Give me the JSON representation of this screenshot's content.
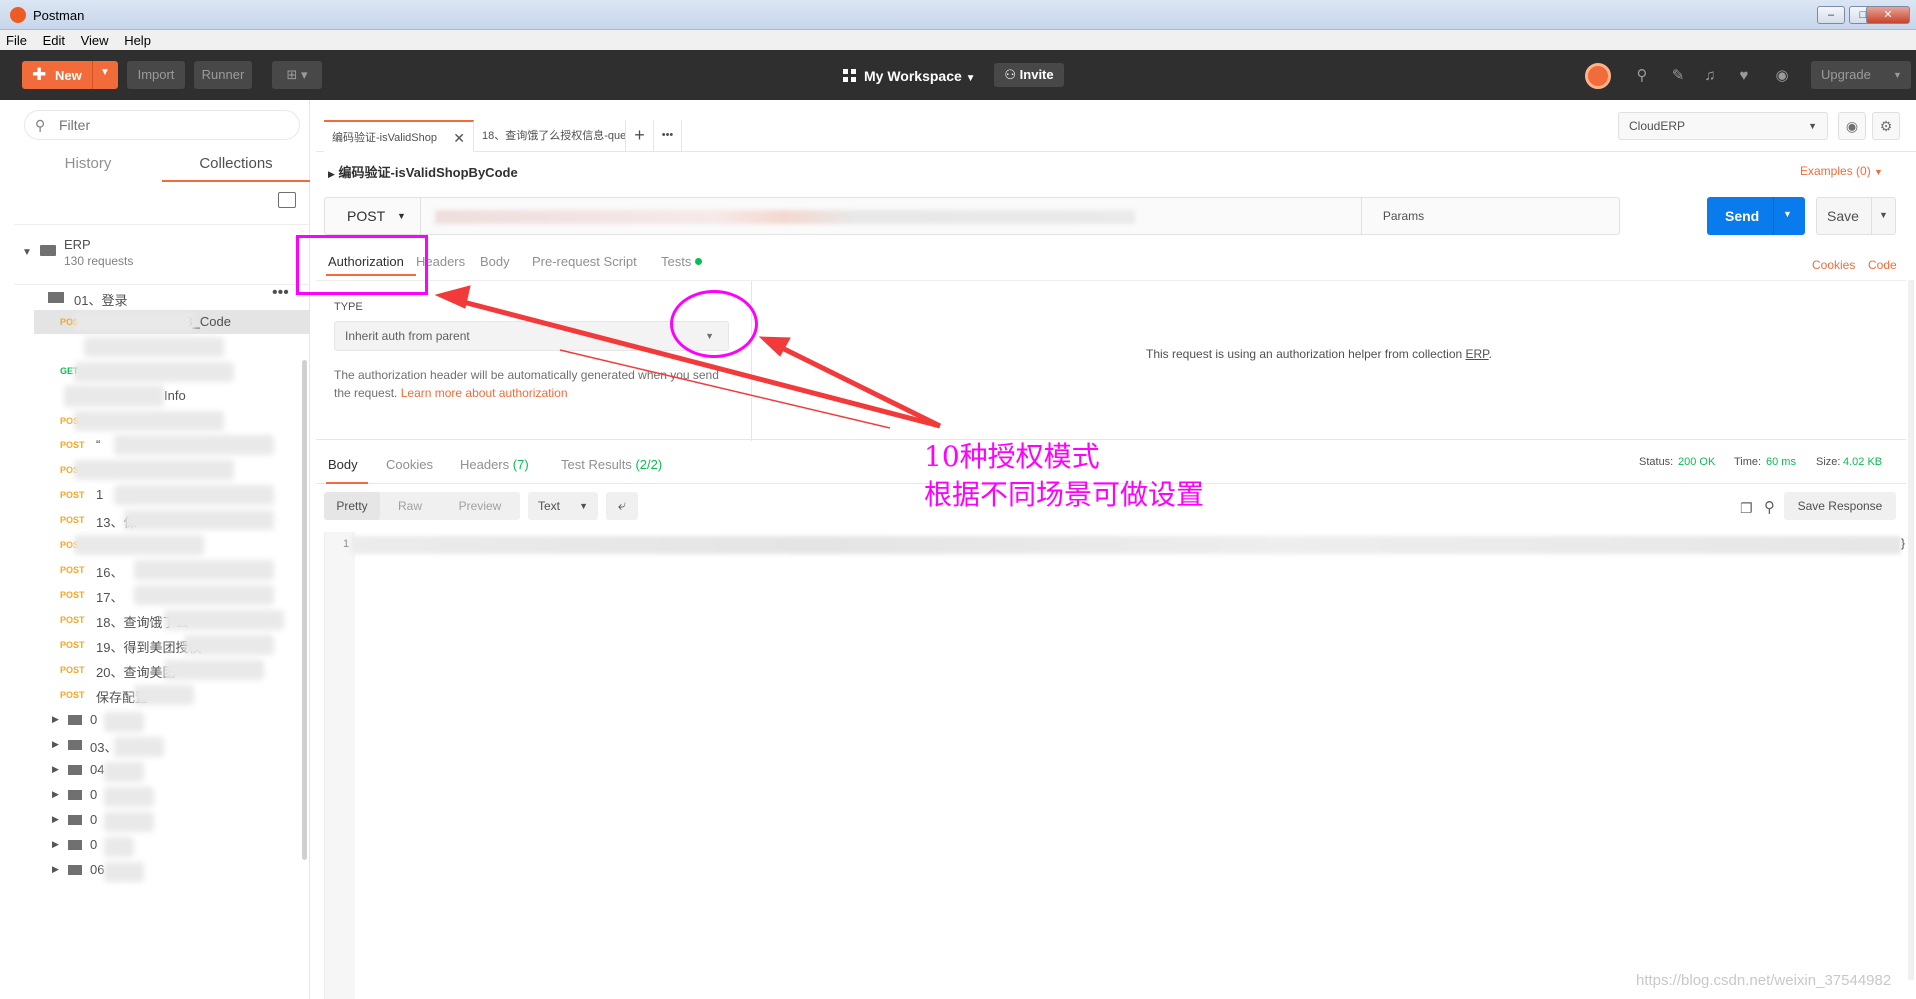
{
  "window": {
    "title": "Postman",
    "minimize": "–",
    "maximize": "□",
    "close": "✕"
  },
  "menu": [
    "File",
    "Edit",
    "View",
    "Help"
  ],
  "header": {
    "new_label": "New",
    "import_label": "Import",
    "runner_label": "Runner",
    "workspace_label": "My Workspace",
    "invite_label": "Invite",
    "upgrade_label": "Upgrade"
  },
  "sidebar": {
    "filter_placeholder": "Filter",
    "tabs": {
      "history": "History",
      "collections": "Collections"
    },
    "collection": {
      "name": "ERP",
      "count": "130 requests"
    },
    "open_folder": "01、登录",
    "requests": [
      {
        "method": "POST",
        "text": "B_Code"
      },
      {
        "method": "",
        "text": ""
      },
      {
        "method": "GET",
        "text": "-"
      },
      {
        "method": "",
        "text": "Info"
      },
      {
        "method": "POST",
        "text": ""
      },
      {
        "method": "POST",
        "text": "“"
      },
      {
        "method": "POST",
        "text": ""
      },
      {
        "method": "POST",
        "text": "1"
      },
      {
        "method": "POST",
        "text": "13、保"
      },
      {
        "method": "POST",
        "text": ""
      },
      {
        "method": "POST",
        "text": "16、"
      },
      {
        "method": "POST",
        "text": "17、"
      },
      {
        "method": "POST",
        "text": "18、查询饿了么"
      },
      {
        "method": "POST",
        "text": "19、得到美团授权"
      },
      {
        "method": "POST",
        "text": "20、查询美团"
      },
      {
        "method": "POST",
        "text": "保存配置"
      }
    ],
    "folders": [
      "0",
      "03、",
      "04",
      "0",
      "0",
      "0",
      "06"
    ]
  },
  "tabs": [
    {
      "label": "编码验证-isValidShop"
    },
    {
      "label": "18、查询饿了么授权信息-que"
    }
  ],
  "tab_add": "+",
  "tab_more": "•••",
  "environment": "CloudERP",
  "request": {
    "name": "编码验证-isValidShopByCode",
    "examples": "Examples (0)",
    "method": "POST",
    "params_label": "Params",
    "send_label": "Send",
    "save_label": "Save"
  },
  "request_tabs": [
    "Authorization",
    "Headers",
    "Body",
    "Pre-request Script",
    "Tests"
  ],
  "request_links": {
    "cookies": "Cookies",
    "code": "Code"
  },
  "auth": {
    "type_label": "TYPE",
    "type_value": "Inherit auth from parent",
    "help_text": "The authorization header will be automatically generated when you send the request.",
    "help_link": "Learn more about authorization",
    "message_prefix": "This request is using an authorization helper from collection ",
    "message_collection": "ERP",
    "message_suffix": "."
  },
  "response": {
    "tabs": [
      {
        "label": "Body",
        "count": ""
      },
      {
        "label": "Cookies",
        "count": ""
      },
      {
        "label": "Headers",
        "count": "(7)"
      },
      {
        "label": "Test Results",
        "count": "(2/2)"
      }
    ],
    "status_label": "Status:",
    "status_value": "200 OK",
    "time_label": "Time:",
    "time_value": "60 ms",
    "size_label": "Size:",
    "size_value": "4.02 KB",
    "view_modes": [
      "Pretty",
      "Raw",
      "Preview"
    ],
    "format": "Text",
    "save_response": "Save Response",
    "line_number": "1",
    "closing_brace": "}"
  },
  "annotation": {
    "line1": "10种授权模式",
    "line2": "根据不同场景可做设置",
    "color": "#ff00ff"
  },
  "watermark": "https://blog.csdn.net/weixin_37544982",
  "colors": {
    "accent": "#f26b3a",
    "send_blue": "#097bed",
    "success_green": "#0cbb52",
    "header_bg": "#2f2f2f"
  }
}
